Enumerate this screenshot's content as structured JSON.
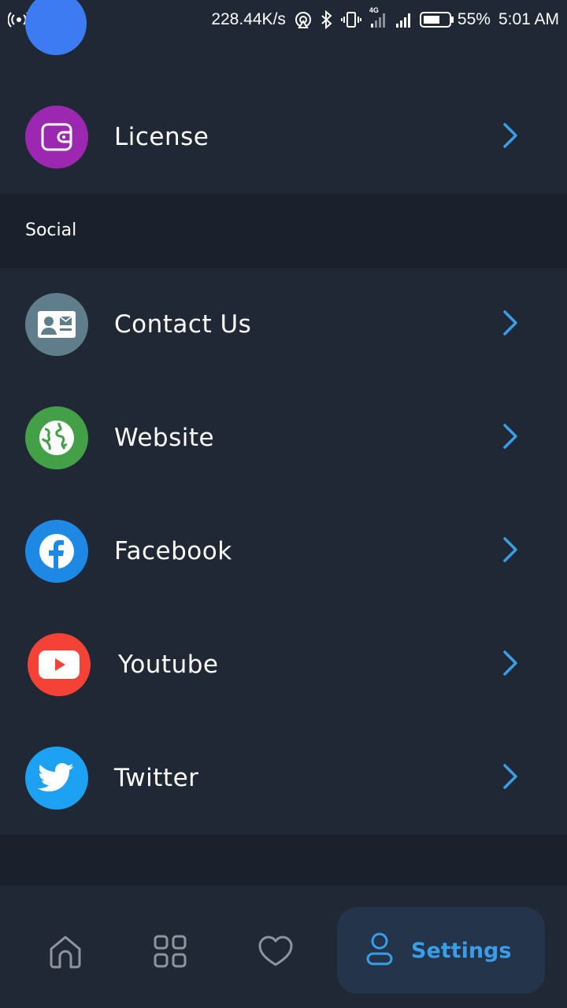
{
  "status_bar": {
    "speed": "228.44K/s",
    "network_label": "4G",
    "battery": "55%",
    "time": "5:01 AM"
  },
  "list_top": {
    "items": [
      {
        "label": "License",
        "icon": "wallet-icon",
        "color": "#9c27b0"
      }
    ]
  },
  "social": {
    "header": "Social",
    "items": [
      {
        "label": "Contact Us",
        "icon": "contact-card-icon",
        "color": "#607d8b"
      },
      {
        "label": "Website",
        "icon": "globe-icon",
        "color": "#43a047"
      },
      {
        "label": "Facebook",
        "icon": "facebook-icon",
        "color": "#1e88e5"
      },
      {
        "label": "Youtube",
        "icon": "youtube-icon",
        "color": "#f44336"
      },
      {
        "label": "Twitter",
        "icon": "twitter-icon",
        "color": "#1da1f2"
      }
    ]
  },
  "bottom_nav": {
    "items": [
      {
        "icon": "home-icon"
      },
      {
        "icon": "grid-icon"
      },
      {
        "icon": "heart-icon"
      },
      {
        "icon": "user-icon",
        "label": "Settings",
        "active": true
      }
    ]
  },
  "colors": {
    "background": "#1b212c",
    "card": "#202835",
    "accent": "#3a9de8",
    "active_nav_bg": "#24344a"
  }
}
